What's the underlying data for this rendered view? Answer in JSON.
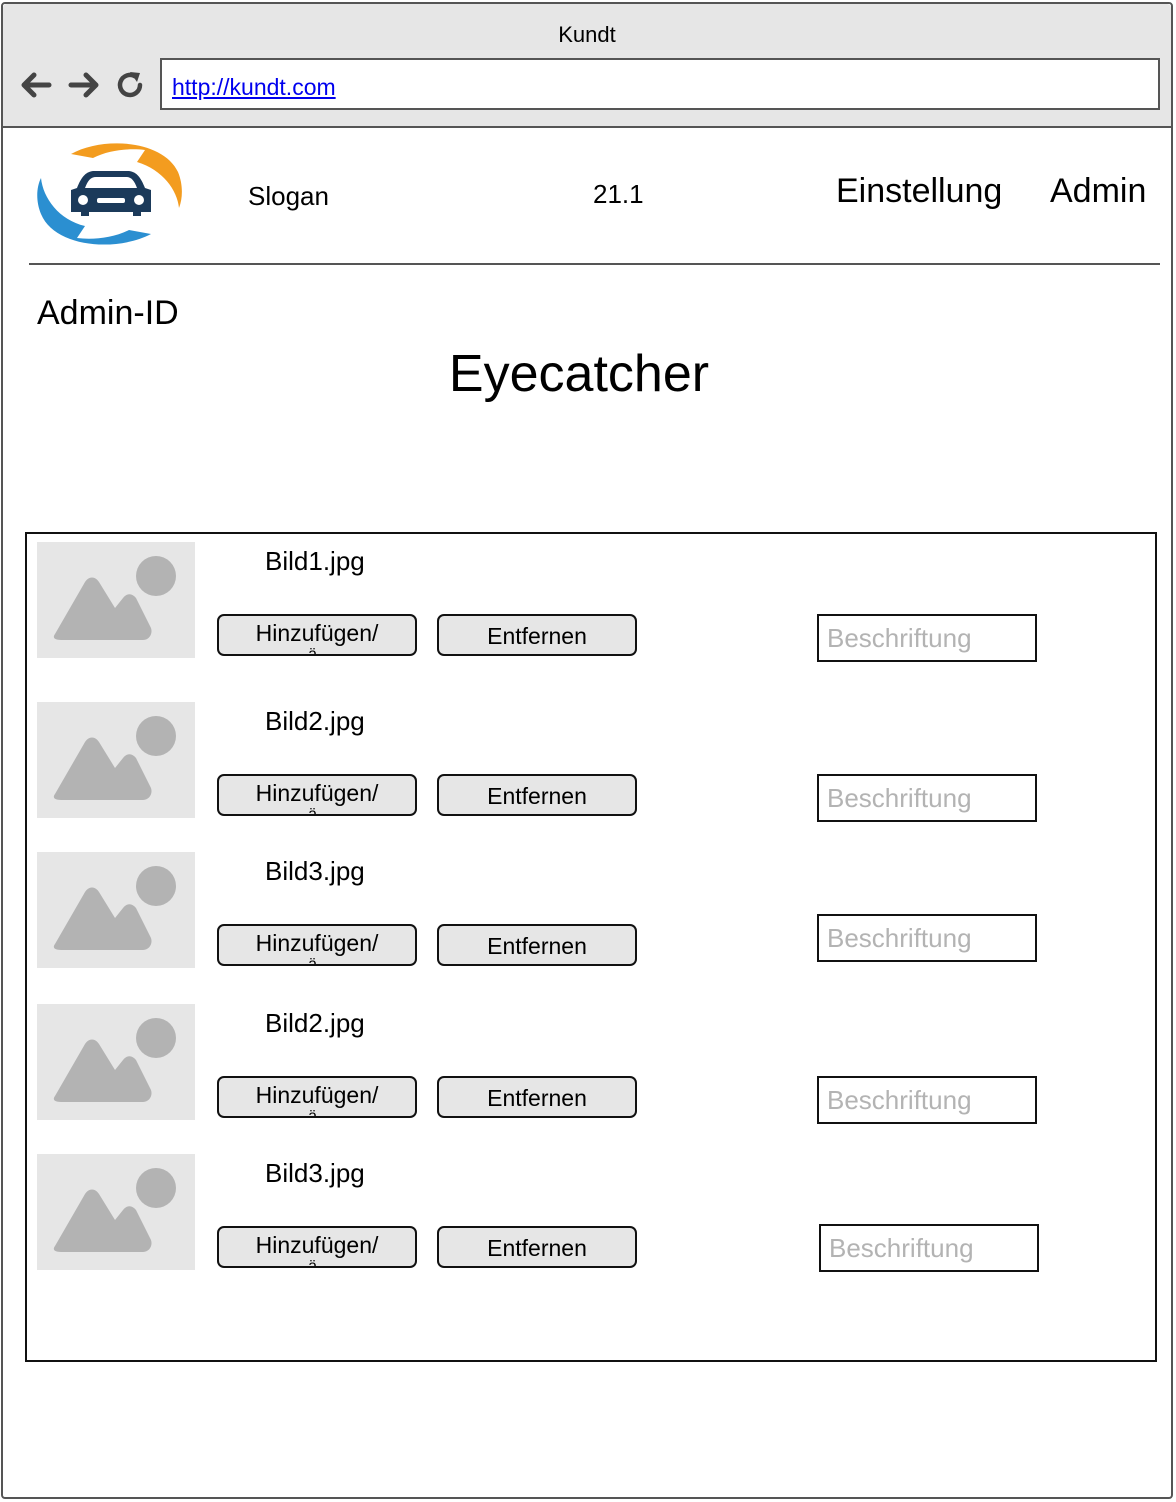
{
  "browser": {
    "title": "Kundt",
    "url": "http://kundt.com",
    "nav_icons": [
      "back-arrow-icon",
      "forward-arrow-icon",
      "reload-icon"
    ]
  },
  "header": {
    "logo_icon": "car-logo-icon",
    "slogan": "Slogan",
    "version": "21.1",
    "nav": [
      "Einstellung",
      "Admin"
    ]
  },
  "main": {
    "admin_id": "Admin-ID",
    "title": "Eyecatcher"
  },
  "images": [
    {
      "file": "Bild1.jpg",
      "add_label": "Hinzufügen/",
      "add_label_overflow": "ä    .",
      "remove_label": "Entfernen",
      "caption_placeholder": "Beschriftung"
    },
    {
      "file": "Bild2.jpg",
      "add_label": "Hinzufügen/",
      "add_label_overflow": "ä    .",
      "remove_label": "Entfernen",
      "caption_placeholder": "Beschriftung"
    },
    {
      "file": "Bild3.jpg",
      "add_label": "Hinzufügen/",
      "add_label_overflow": "ä    .",
      "remove_label": "Entfernen",
      "caption_placeholder": "Beschriftung"
    },
    {
      "file": "Bild2.jpg",
      "add_label": "Hinzufügen/",
      "add_label_overflow": "ä    .",
      "remove_label": "Entfernen",
      "caption_placeholder": "Beschriftung"
    },
    {
      "file": "Bild3.jpg",
      "add_label": "Hinzufügen/",
      "add_label_overflow": "ä    .",
      "remove_label": "Entfernen",
      "caption_placeholder": "Beschriftung"
    }
  ],
  "colors": {
    "chrome_bg": "#e6e6e6",
    "border": "#555555",
    "logo_orange": "#f39c1f",
    "logo_blue": "#2b8fd1",
    "logo_car": "#1b3a5a",
    "placeholder_text": "#b3b3b3",
    "thumb_bg": "#e6e6e6",
    "thumb_shape": "#b3b3b3"
  }
}
